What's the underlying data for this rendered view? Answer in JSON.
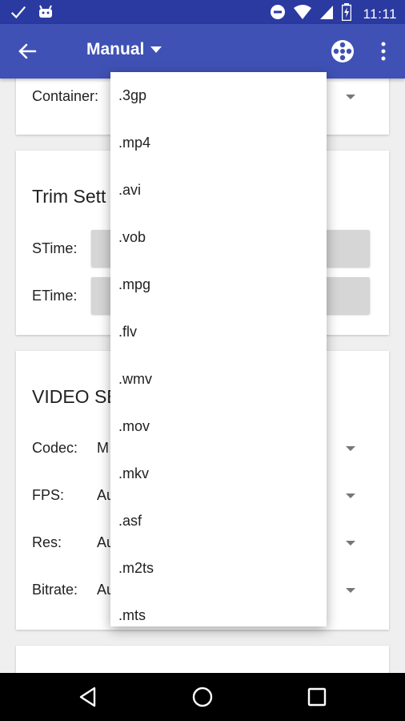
{
  "status_bar": {
    "time": "11:11",
    "icons": [
      "check-icon",
      "android-icon",
      "do-not-disturb-icon",
      "wifi-icon",
      "signal-icon",
      "battery-charging-icon"
    ]
  },
  "app_bar": {
    "title": "Manual",
    "icons": [
      "back-arrow-icon",
      "dropdown-triangle-icon",
      "film-reel-icon",
      "more-vert-icon"
    ]
  },
  "container_card": {
    "label": "Container:"
  },
  "trim_card": {
    "heading": "Trim Sett",
    "stime_label": "STime:",
    "etime_label": "ETime:"
  },
  "video_card": {
    "heading": "VIDEO SE",
    "codec_label": "Codec:",
    "codec_value": "M",
    "fps_label": "FPS:",
    "fps_value": "Au",
    "res_label": "Res:",
    "res_value": "Au",
    "bitrate_label": "Bitrate:",
    "bitrate_value": "Au"
  },
  "dropdown": {
    "options": [
      ".3gp",
      ".mp4",
      ".avi",
      ".vob",
      ".mpg",
      ".flv",
      ".wmv",
      ".mov",
      ".mkv",
      ".asf",
      ".m2ts",
      ".mts"
    ]
  },
  "nav_bar": {
    "icons": [
      "back-triangle-icon",
      "home-circle-icon",
      "recents-square-icon"
    ]
  }
}
